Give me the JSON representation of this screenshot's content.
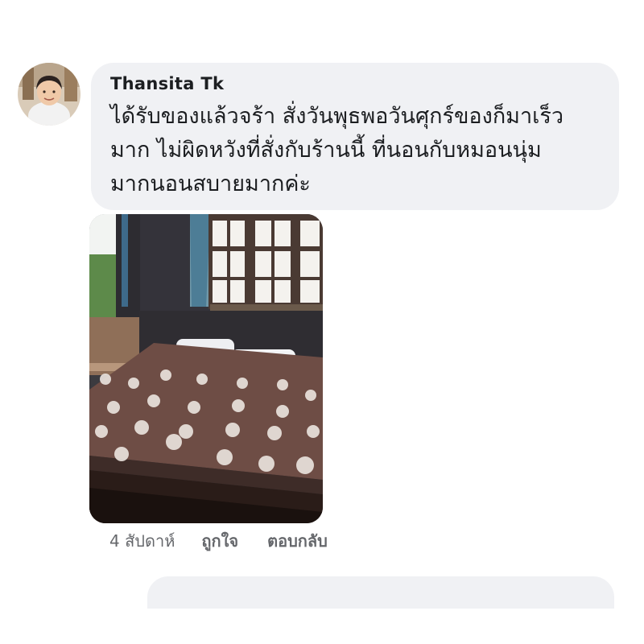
{
  "comment": {
    "author": "Thansita Tk",
    "text": "ได้รับของแล้วจร้า  สั่งวันพุธพอวันศุกร์ของก็มาเร็ว\nมาก  ไม่ผิดหวังที่สั่งกับร้านนี้ ที่นอนกับหมอนนุ่ม\nมากนอนสบายมากค่ะ",
    "timestamp": "4 สัปดาห์",
    "like_label": "ถูกใจ",
    "reply_label": "ตอบกลับ"
  },
  "colors": {
    "bubble_bg": "#f0f1f4",
    "text": "#1c1e21",
    "meta_text": "#65676b",
    "mattress": "#6e4d45"
  },
  "icons": {
    "avatar": "user-profile-photo",
    "photo": "bedroom-mattress-photo"
  }
}
